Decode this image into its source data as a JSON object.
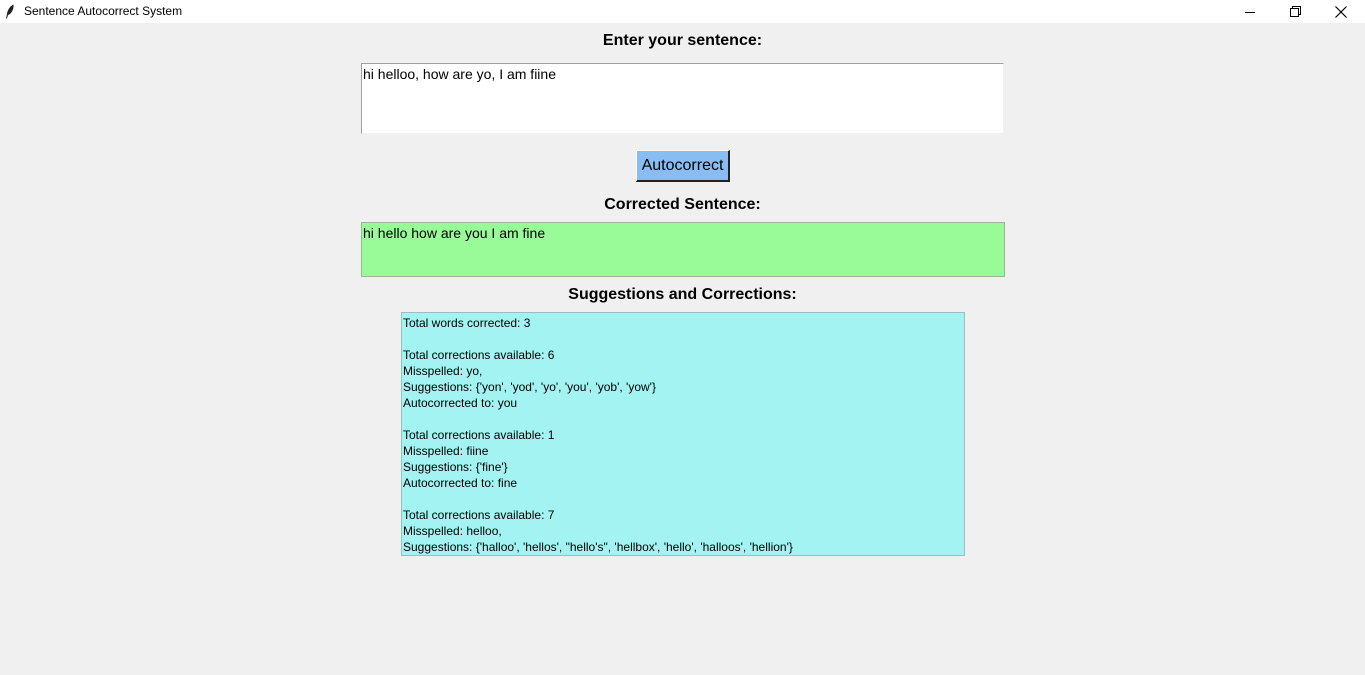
{
  "window": {
    "title": "Sentence Autocorrect System",
    "icons": [
      "feather-icon",
      "minimize-icon",
      "maximize-icon",
      "close-icon"
    ]
  },
  "input_section": {
    "heading": "Enter your sentence:",
    "value": "hi helloo, how are yo, I am fiine"
  },
  "autocorrect_button": {
    "label": "Autocorrect",
    "color": "#87bdf2"
  },
  "corrected_section": {
    "heading": "Corrected Sentence:",
    "value": "hi hello how are you I am fine",
    "background": "#98fb98"
  },
  "suggestions_section": {
    "heading": "Suggestions and Corrections:",
    "background": "#a3f3f3",
    "lines": [
      "Total words corrected: 3",
      "",
      "Total corrections available: 6",
      "Misspelled: yo,",
      "Suggestions: {'yon', 'yod', 'yo', 'you', 'yob', 'yow'}",
      "Autocorrected to: you",
      "",
      "Total corrections available: 1",
      "Misspelled: fiine",
      "Suggestions: {'fine'}",
      "Autocorrected to: fine",
      "",
      "Total corrections available: 7",
      "Misspelled: helloo,",
      "Suggestions: {'halloo', 'hellos', \"hello's\", 'hellbox', 'hello', 'halloos', 'hellion'}"
    ]
  }
}
